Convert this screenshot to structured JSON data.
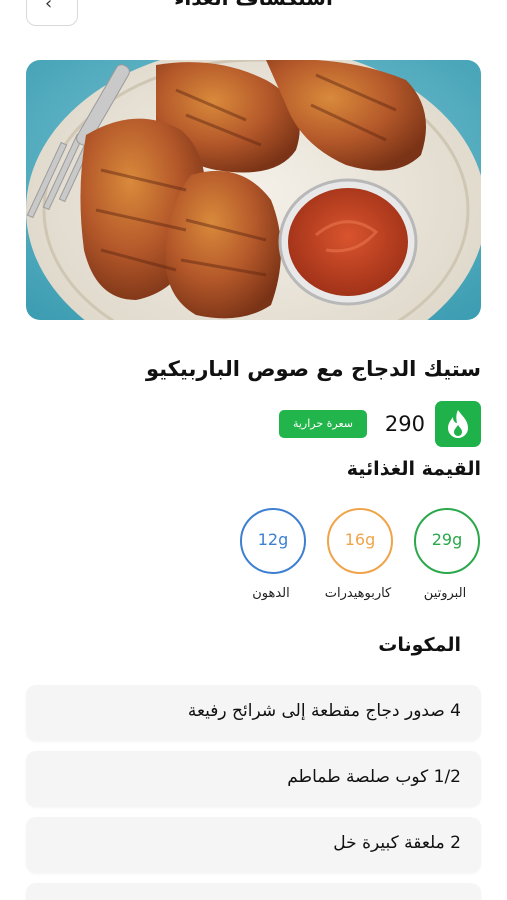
{
  "header": {
    "title": "استكشاف الغذاء",
    "back_icon": "chevron-left-icon"
  },
  "recipe": {
    "title": "ستيك الدجاج مع صوص الباربيكيو",
    "image": "bbq-chicken-steak-photo",
    "calories": "290",
    "calories_label": "سعرة حرارية",
    "calorie_icon": "flame-icon"
  },
  "nutrition": {
    "title": "القيمة الغذائية",
    "macros": [
      {
        "label": "البروتين",
        "value": "29g",
        "color": "#2aa84a"
      },
      {
        "label": "كاربوهيدرات",
        "value": "16g",
        "color": "#f0a44a"
      },
      {
        "label": "الدهون",
        "value": "12g",
        "color": "#3d7fd1"
      }
    ]
  },
  "ingredients": {
    "title": "المكونات",
    "items": [
      "4 صدور دجاج مقطعة إلى شرائح رفيعة",
      "1/2 كوب صلصة طماطم",
      "2 ملعقة كبيرة خل",
      ""
    ]
  }
}
